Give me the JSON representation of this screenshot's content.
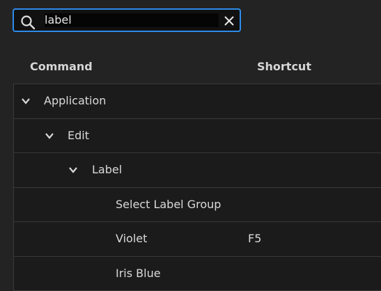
{
  "search": {
    "value": "label",
    "icon": "search-icon",
    "clear_icon": "close-icon"
  },
  "columns": {
    "command": "Command",
    "shortcut": "Shortcut"
  },
  "rows": [
    {
      "label": "Application",
      "level": 0,
      "expanded": true,
      "shortcut": ""
    },
    {
      "label": "Edit",
      "level": 1,
      "expanded": true,
      "shortcut": ""
    },
    {
      "label": "Label",
      "level": 2,
      "expanded": true,
      "shortcut": ""
    },
    {
      "label": "Select Label Group",
      "level": 3,
      "shortcut": ""
    },
    {
      "label": "Violet",
      "level": 3,
      "shortcut": "F5"
    },
    {
      "label": "Iris Blue",
      "level": 3,
      "shortcut": ""
    }
  ],
  "colors": {
    "accent": "#2d8ceb",
    "background": "#232323",
    "row": "#1b1b1b"
  }
}
